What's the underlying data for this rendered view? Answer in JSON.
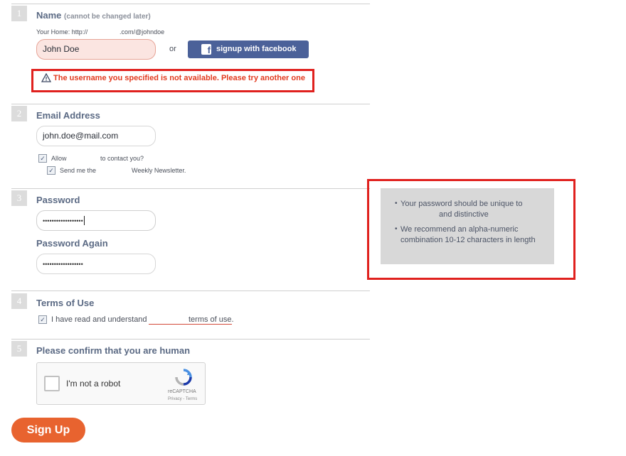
{
  "sections": [
    {
      "number": "1",
      "title": "Name",
      "subtitle": "(cannot be changed later)"
    },
    {
      "number": "2",
      "title": "Email Address"
    },
    {
      "number": "3",
      "title": "Password",
      "secondary_label": "Password Again"
    },
    {
      "number": "4",
      "title": "Terms of Use"
    },
    {
      "number": "5",
      "title": "Please confirm that you are human"
    }
  ],
  "name": {
    "home_prefix": "Your Home: http://",
    "home_suffix": ".com/@johndoe",
    "value": "John Doe",
    "or_label": "or",
    "facebook_label": "signup with facebook",
    "facebook_icon": "facebook-f-icon",
    "error_icon": "warning-triangle-icon",
    "error_message": "The username you specified is not available. Please try another one"
  },
  "email": {
    "value": "john.doe@mail.com",
    "allow_prefix": "Allow",
    "allow_suffix": "to contact you?",
    "allow_checked": true,
    "newsletter_prefix": "Send me the",
    "newsletter_suffix": "Weekly Newsletter.",
    "newsletter_checked": true
  },
  "password": {
    "value_masked": "••••••••••••••••••",
    "again_masked": "••••••••••••••••••",
    "tips": [
      {
        "line1": "Your password should be unique to",
        "line2": "and distinctive"
      },
      {
        "line1": "We recommend an alpha-numeric",
        "line2": "combination 10-12 characters in length"
      }
    ]
  },
  "terms": {
    "checked": true,
    "prefix": "I have read and understand",
    "link": "terms of use",
    "suffix": "."
  },
  "captcha": {
    "label": "I'm not a robot",
    "brand": "reCAPTCHA",
    "links": "Privacy - Terms",
    "logo_icon": "recaptcha-logo-icon"
  },
  "submit_label": "Sign Up",
  "colors": {
    "accent": "#e8632f",
    "error": "#e23a1f",
    "highlight_box": "#e0211e",
    "facebook": "#4b6199",
    "section_title": "#5b6a84"
  }
}
